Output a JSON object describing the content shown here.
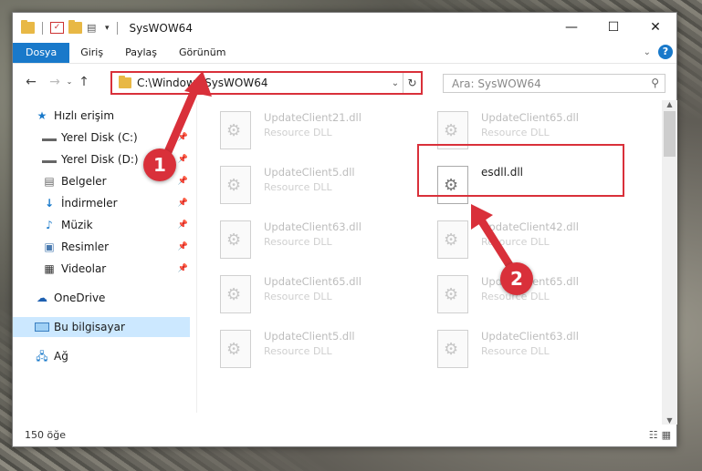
{
  "window": {
    "title": "SysWOW64"
  },
  "ribbon": {
    "tabs": [
      "Dosya",
      "Giriş",
      "Paylaş",
      "Görünüm"
    ]
  },
  "address": {
    "path": "C:\\Windows\\SysWOW64"
  },
  "search": {
    "placeholder": "Ara: SysWOW64"
  },
  "nav": {
    "quick_access": "Hızlı erişim",
    "items": [
      "Yerel Disk (C:)",
      "Yerel Disk (D:)",
      "Belgeler",
      "İndirmeler",
      "Müzik",
      "Resimler",
      "Videolar"
    ],
    "onedrive": "OneDrive",
    "this_pc": "Bu bilgisayar",
    "network": "Ağ"
  },
  "files": [
    {
      "name": "UpdateClient21.dll",
      "type": "Resource DLL"
    },
    {
      "name": "UpdateClient65.dll",
      "type": "Resource DLL"
    },
    {
      "name": "UpdateClient5.dll",
      "type": "Resource DLL"
    },
    {
      "name": "esdll.dll",
      "type": ""
    },
    {
      "name": "UpdateClient63.dll",
      "type": "Resource DLL"
    },
    {
      "name": "UpdateClient42.dll",
      "type": "Resource DLL"
    },
    {
      "name": "UpdateClient65.dll",
      "type": "Resource DLL"
    },
    {
      "name": "UpdateClient65.dll",
      "type": "Resource DLL"
    },
    {
      "name": "UpdateClient5.dll",
      "type": "Resource DLL"
    },
    {
      "name": "UpdateClient63.dll",
      "type": "Resource DLL"
    }
  ],
  "status": {
    "count": "150 öğe"
  },
  "annotations": {
    "badge1": "1",
    "badge2": "2"
  },
  "colors": {
    "accent": "#1979ca",
    "highlight": "#d9303a"
  }
}
